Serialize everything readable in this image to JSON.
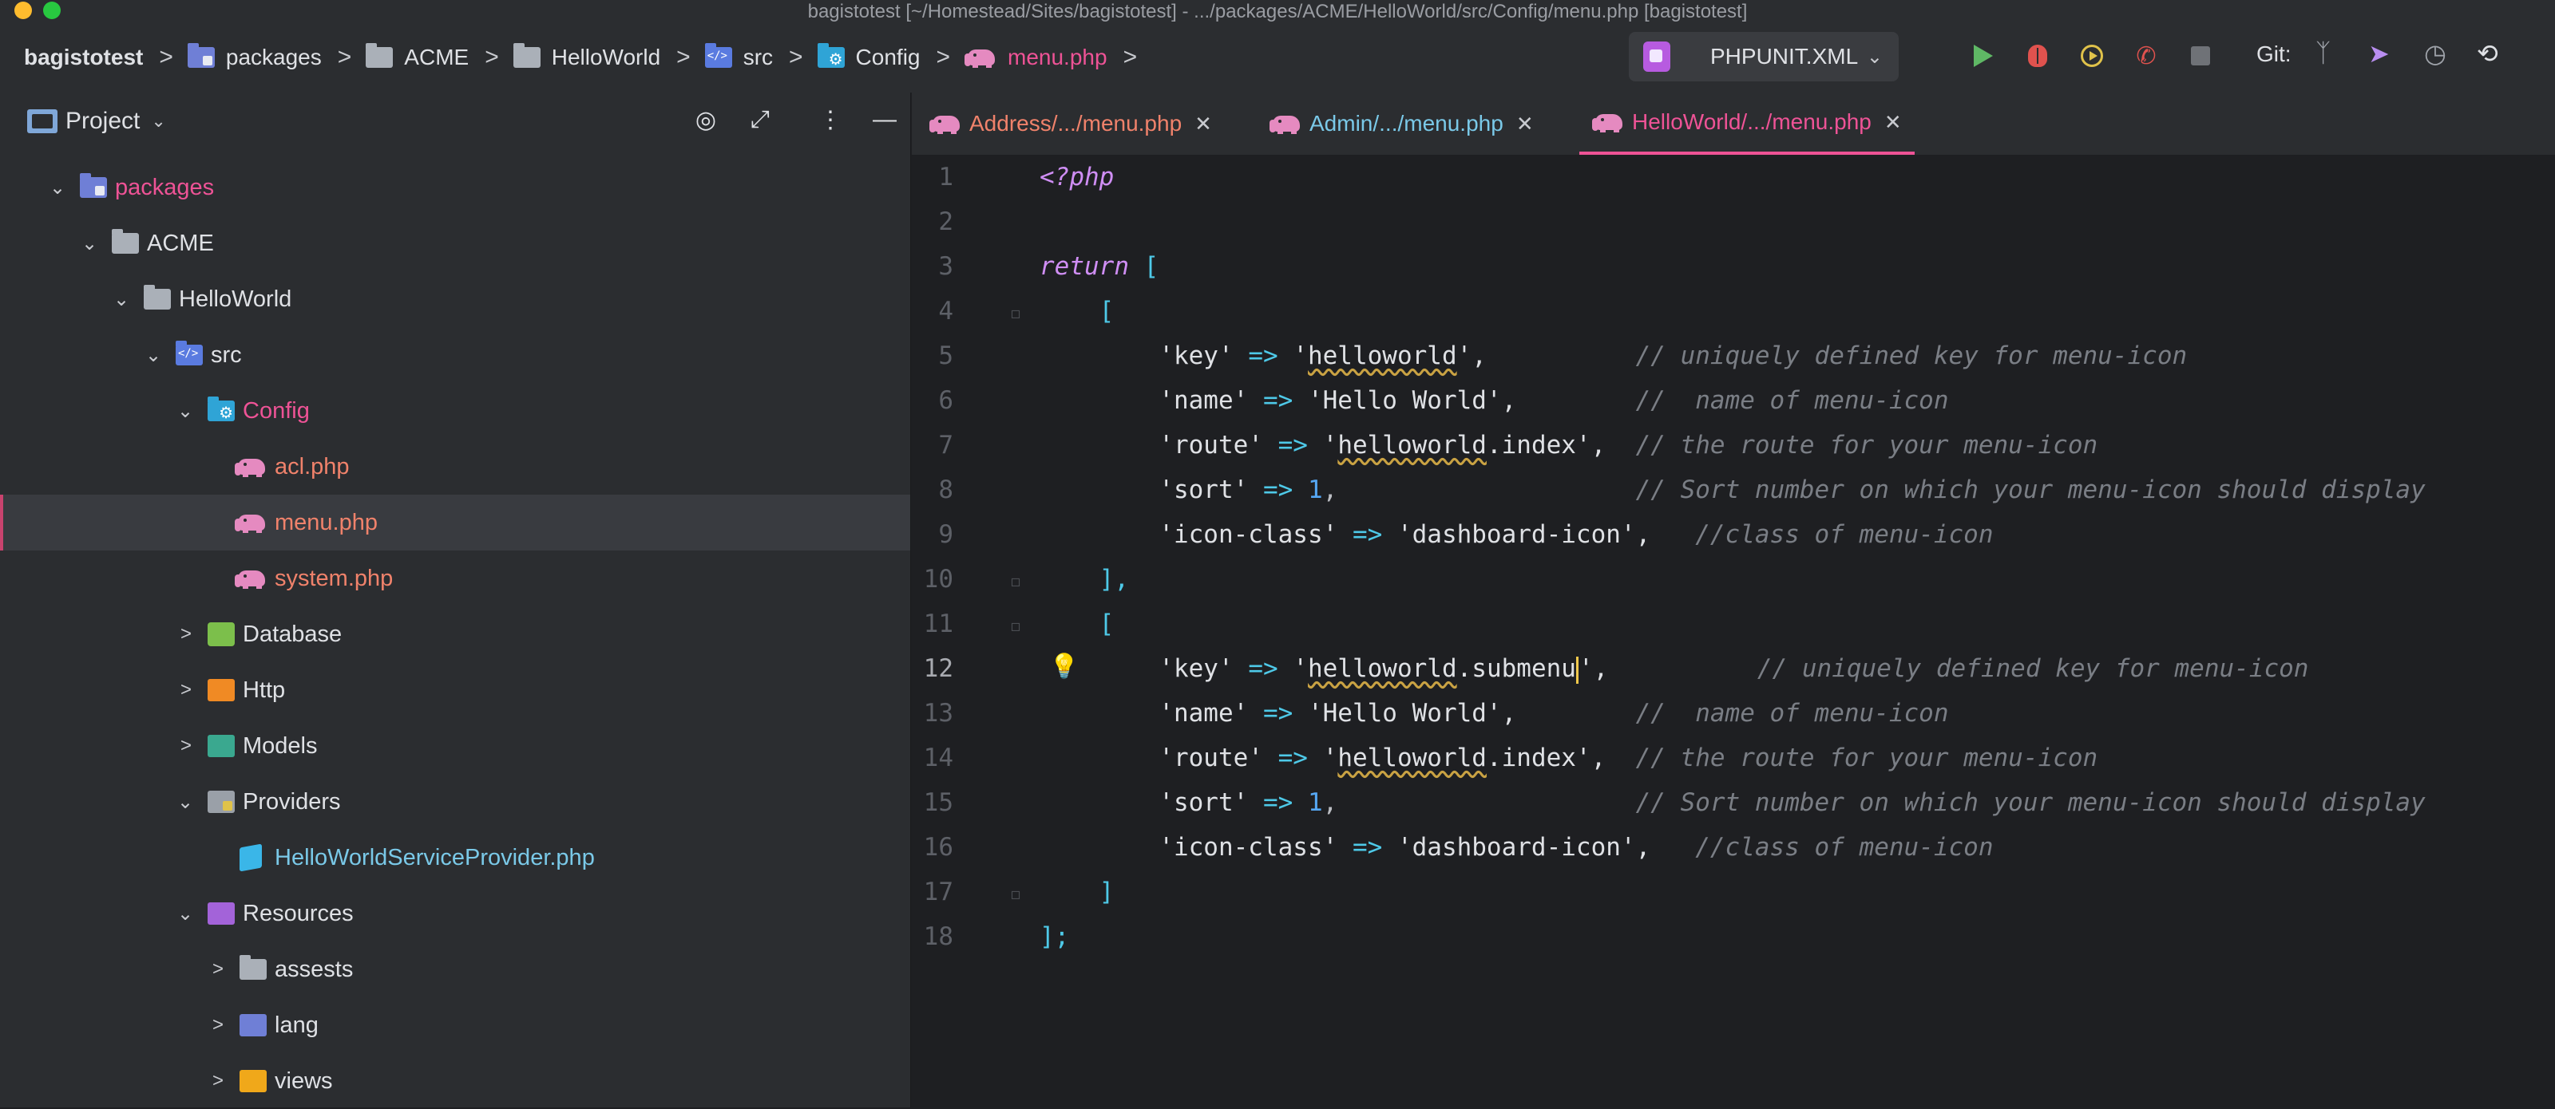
{
  "window": {
    "title": "bagistotest [~/Homestead/Sites/bagistotest] - .../packages/ACME/HelloWorld/src/Config/menu.php [bagistotest]"
  },
  "breadcrumbs": [
    "bagistotest",
    "packages",
    "ACME",
    "HelloWorld",
    "src",
    "Config",
    "menu.php"
  ],
  "toolbar": {
    "run_config": "PHPUNIT.XML",
    "git_label": "Git:"
  },
  "project_panel": {
    "title": "Project",
    "tree": [
      {
        "label": "packages",
        "expanded": true
      },
      {
        "label": "ACME",
        "expanded": true
      },
      {
        "label": "HelloWorld",
        "expanded": true
      },
      {
        "label": "src",
        "expanded": true
      },
      {
        "label": "Config",
        "expanded": true
      },
      {
        "label": "acl.php"
      },
      {
        "label": "menu.php",
        "selected": true
      },
      {
        "label": "system.php"
      },
      {
        "label": "Database",
        "expanded": false
      },
      {
        "label": "Http",
        "expanded": false
      },
      {
        "label": "Models",
        "expanded": false
      },
      {
        "label": "Providers",
        "expanded": true
      },
      {
        "label": "HelloWorldServiceProvider.php"
      },
      {
        "label": "Resources",
        "expanded": true
      },
      {
        "label": "assests",
        "expanded": false
      },
      {
        "label": "lang",
        "expanded": false
      },
      {
        "label": "views",
        "expanded": false
      }
    ]
  },
  "editor": {
    "tabs": [
      {
        "label": "Address/.../menu.php",
        "color": "#f0826b"
      },
      {
        "label": "Admin/.../menu.php",
        "color": "#7ac9e8"
      },
      {
        "label": "HelloWorld/.../menu.php",
        "color": "#ee5396",
        "active": true
      }
    ],
    "line_numbers": [
      "1",
      "2",
      "3",
      "4",
      "5",
      "6",
      "7",
      "8",
      "9",
      "10",
      "11",
      "12",
      "13",
      "14",
      "15",
      "16",
      "17",
      "18"
    ],
    "current_line": 12,
    "code": {
      "l1": "<?php",
      "l3_kw": "return",
      "l3_br": " [",
      "l4": "[",
      "l5_key": "'key'",
      "l5_val_a": "'",
      "l5_val_b": "helloworld",
      "l5_val_c": "',",
      "l5_com": "// uniquely defined key for menu-icon",
      "l6_key": "'name'",
      "l6_val": "'Hello World',",
      "l6_com": "//  name of menu-icon",
      "l7_key": "'route'",
      "l7_val_a": "'",
      "l7_val_b": "helloworld",
      "l7_val_c": ".index',",
      "l7_com": "// the route for your menu-icon",
      "l8_key": "'sort'",
      "l8_val": "1",
      "l8_com": "// Sort number on which your menu-icon should display",
      "l9_key": "'icon-class'",
      "l9_val": "'dashboard-icon',",
      "l9_com": "//class of menu-icon",
      "l10": "],",
      "l11": "[",
      "l12_key": "'key'",
      "l12_val_a": "'",
      "l12_val_b": "helloworld",
      "l12_val_c": ".submenu",
      "l12_val_d": "',",
      "l12_com": "// uniquely defined key for menu-icon",
      "l13_key": "'name'",
      "l13_val": "'Hello World',",
      "l13_com": "//  name of menu-icon",
      "l14_key": "'route'",
      "l14_val_a": "'",
      "l14_val_b": "helloworld",
      "l14_val_c": ".index',",
      "l14_com": "// the route for your menu-icon",
      "l15_key": "'sort'",
      "l15_val": "1",
      "l15_com": "// Sort number on which your menu-icon should display",
      "l16_key": "'icon-class'",
      "l16_val": "'dashboard-icon',",
      "l16_com": "//class of menu-icon",
      "l17": "]",
      "l18": "];",
      "arrow": "=>",
      "comma": ","
    }
  },
  "colors": {
    "accent": "#ee5396",
    "background": "#1e1f22",
    "panel": "#2b2d30"
  }
}
